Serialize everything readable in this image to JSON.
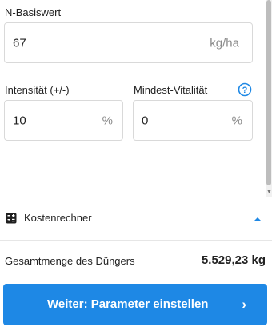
{
  "form": {
    "n_base_label": "N-Basiswert",
    "n_base_value": "67",
    "n_base_unit": "kg/ha",
    "intensity_label": "Intensität (+/-)",
    "intensity_value": "10",
    "intensity_unit": "%",
    "min_vitality_label": "Mindest-Vitalität",
    "min_vitality_value": "0",
    "min_vitality_unit": "%"
  },
  "calculator": {
    "title": "Kostenrechner",
    "total_label": "Gesamtmenge des Düngers",
    "total_value": "5.529,23 kg"
  },
  "cta": {
    "label": "Weiter: Parameter einstellen",
    "chevron": "›"
  },
  "colors": {
    "accent": "#1e88e5"
  },
  "icons": [
    "help-icon",
    "calculator-icon",
    "chevron-up-icon",
    "chevron-right-icon"
  ]
}
